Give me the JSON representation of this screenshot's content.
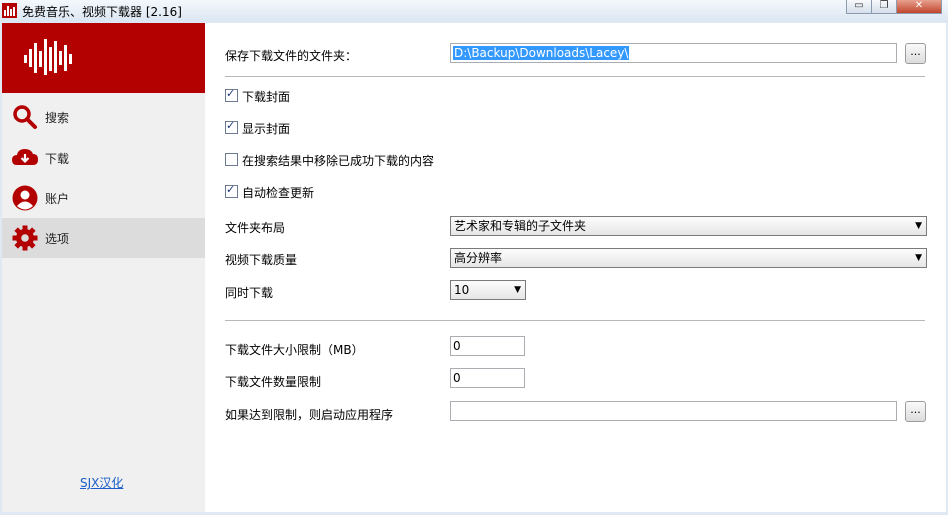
{
  "window": {
    "title": "免费音乐、视频下载器 [2.16]",
    "minimize_glyph": "▭",
    "maximize_glyph": "❐",
    "close_glyph": "✕"
  },
  "colors": {
    "brand_red": "#b30000",
    "link_blue": "#1a5ec9",
    "selection_blue": "#3399ff"
  },
  "sidebar": {
    "items": [
      {
        "icon": "search-icon",
        "label": "搜索"
      },
      {
        "icon": "cloud-download-icon",
        "label": "下载"
      },
      {
        "icon": "user-icon",
        "label": "账户"
      },
      {
        "icon": "gear-icon",
        "label": "选项",
        "active": true
      }
    ],
    "credit_link": "SJX汉化"
  },
  "settings": {
    "folder_label": "保存下载文件的文件夹：",
    "folder_value": "D:\\Backup\\Downloads\\Lacey\\",
    "browse_label": "...",
    "checkboxes": [
      {
        "label": "下载封面",
        "checked": true
      },
      {
        "label": "显示封面",
        "checked": true
      },
      {
        "label": "在搜索结果中移除已成功下载的内容",
        "checked": false
      },
      {
        "label": "自动检查更新",
        "checked": true
      }
    ],
    "check_mark": "✓",
    "folder_layout_label": "文件夹布局",
    "folder_layout_value": "艺术家和专辑的子文件夹",
    "video_quality_label": "视频下载质量",
    "video_quality_value": "高分辨率",
    "concurrent_label": "同时下载",
    "concurrent_value": "10",
    "dropdown_arrow": "▼",
    "size_limit_label": "下载文件大小限制（MB）",
    "size_limit_value": "0",
    "count_limit_label": "下载文件数量限制",
    "count_limit_value": "0",
    "on_limit_label": "如果达到限制，则启动应用程序",
    "on_limit_value": "",
    "on_limit_browse_label": "..."
  }
}
